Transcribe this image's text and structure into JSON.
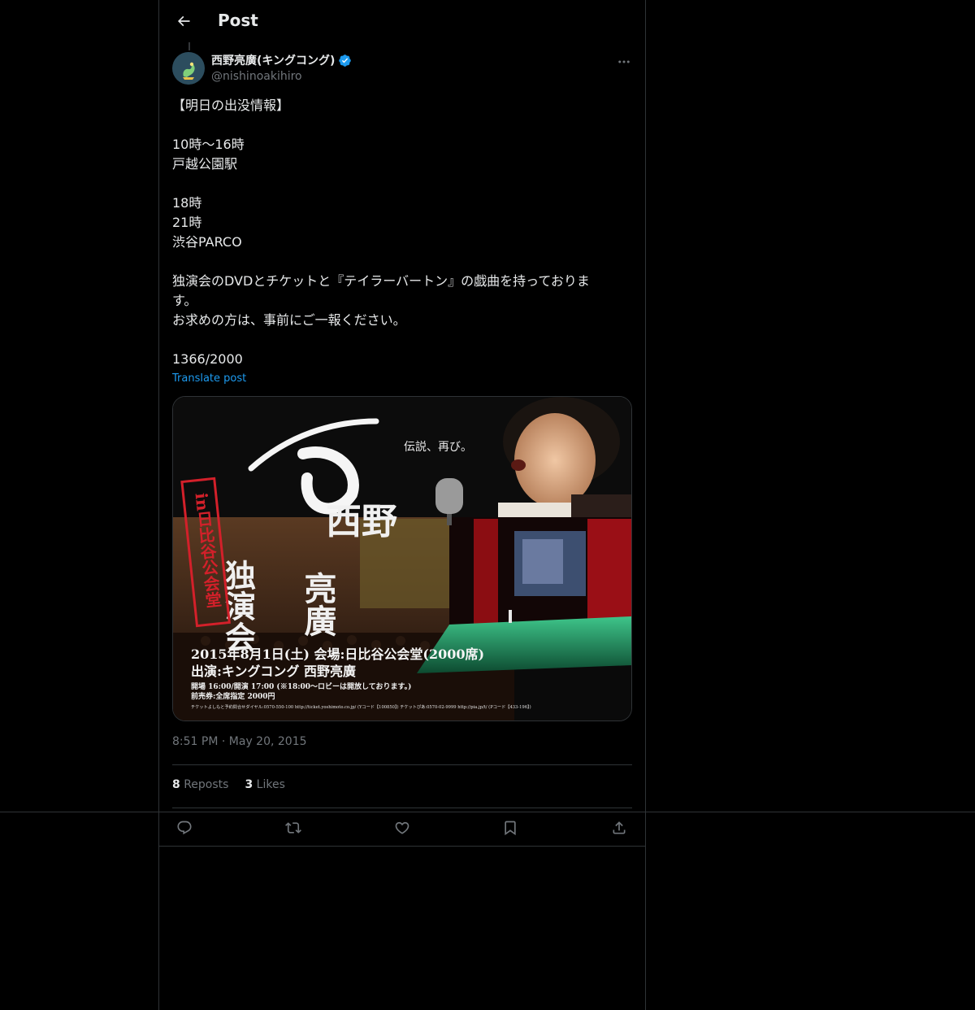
{
  "header": {
    "title": "Post"
  },
  "author": {
    "name": "西野亮廣(キングコング)",
    "handle": "@nishinoakihiro"
  },
  "post": {
    "lines": [
      "【明日の出没情報】",
      "",
      "10時〜16時",
      "戸越公園駅",
      "",
      "18時",
      "21時",
      "渋谷PARCO",
      "",
      "独演会のDVDとチケットと『テイラーバートン』の戯曲を持っておりま",
      "す。",
      "お求めの方は、事前にご一報ください。",
      "",
      "1366/2000"
    ],
    "translate_label": "Translate post"
  },
  "media": {
    "tagline": "伝説、再び。",
    "vertical_title": "in日比谷公会堂",
    "calligraphy_top": "西野",
    "calligraphy_left": "独演会",
    "calligraphy_right": "亮廣",
    "event_line": "2015年8月1日(土) 会場:日比谷公会堂(2000席)",
    "performer_line": "出演:キングコング 西野亮廣",
    "times_line": "開場 16:00/開演 17:00 (※18:00〜ロビーは開放しております。)",
    "price_line": "前売券:全席指定 2000円",
    "ticket_line": "チケットよしもと予約問合せダイヤル:0570-550-100 http://ticket.yoshimoto.co.jp/ (Yコード【100850】) チケットぴあ:0570-02-9999 http://pia.jp/t/ (Pコード【433-196】)"
  },
  "timestamp": {
    "time": "8:51 PM",
    "dot": "·",
    "date": "May 20, 2015"
  },
  "stats": {
    "reposts_count": "8",
    "reposts_label": "Reposts",
    "likes_count": "3",
    "likes_label": "Likes"
  },
  "icons": [
    "back-arrow-icon",
    "verified-badge-icon",
    "more-icon",
    "reply-icon",
    "repost-icon",
    "like-icon",
    "bookmark-icon",
    "share-icon"
  ],
  "colors": {
    "background": "#000000",
    "text": "#e7e9ea",
    "muted": "#71767b",
    "accent": "#1d9bf0",
    "border": "#2f3336"
  }
}
